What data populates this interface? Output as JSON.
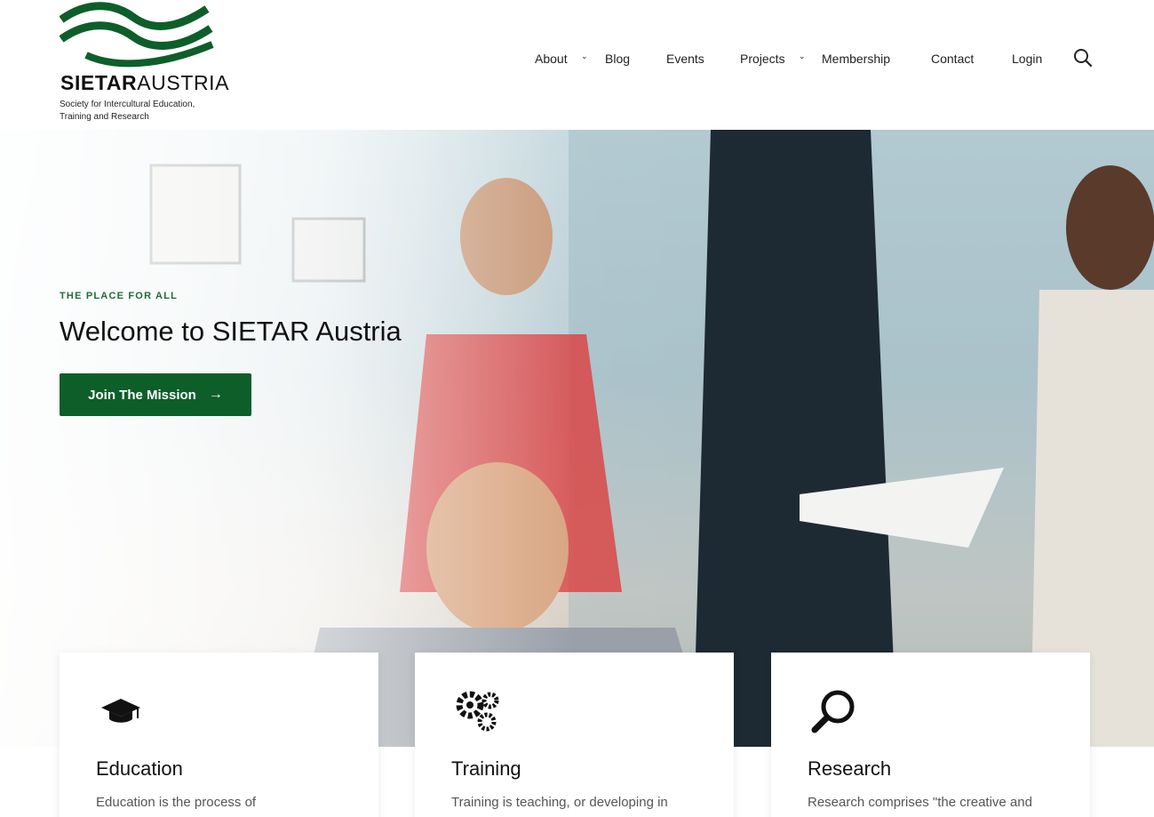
{
  "brand": {
    "name_bold": "SIETAR",
    "name_regular": "AUSTRIA",
    "tagline": "Society for Intercultural Education, Training and Research",
    "color": "#0e5e2a"
  },
  "nav": {
    "items": [
      {
        "label": "About",
        "has_dropdown": true
      },
      {
        "label": "Blog",
        "has_dropdown": false
      },
      {
        "label": "Events",
        "has_dropdown": false
      },
      {
        "label": "Projects",
        "has_dropdown": true
      },
      {
        "label": "Membership",
        "has_dropdown": false
      },
      {
        "label": "Contact",
        "has_dropdown": false
      },
      {
        "label": "Login",
        "has_dropdown": false
      }
    ],
    "search_icon": "search-icon"
  },
  "hero": {
    "eyebrow": "THE PLACE FOR ALL",
    "title": "Welcome to SIETAR Austria",
    "cta_label": "Join The Mission",
    "cta_icon": "arrow-right-icon"
  },
  "cards": [
    {
      "icon": "graduation-cap-icon",
      "title": "Education",
      "text": "Education is the process of"
    },
    {
      "icon": "gears-icon",
      "title": "Training",
      "text": "Training is teaching, or developing in"
    },
    {
      "icon": "magnifier-icon",
      "title": "Research",
      "text": "Research comprises \"the creative and"
    }
  ]
}
